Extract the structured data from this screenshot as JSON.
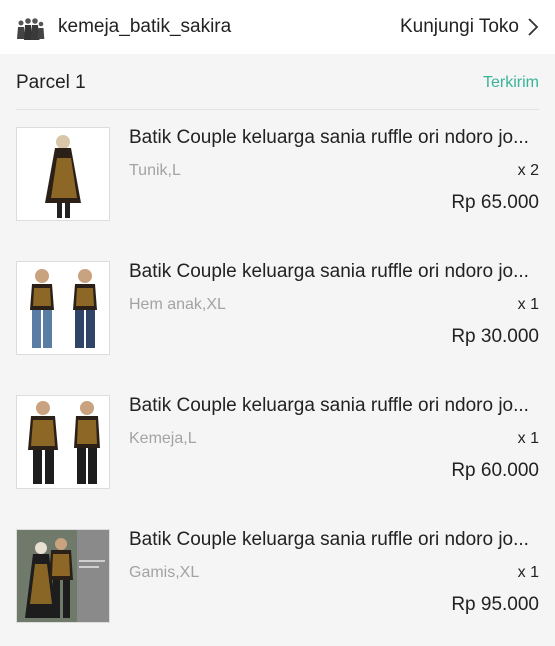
{
  "shop": {
    "name": "kemeja_batik_sakira",
    "visit_label": "Kunjungi Toko"
  },
  "parcel": {
    "title": "Parcel 1",
    "status": "Terkirim"
  },
  "items": [
    {
      "name": "Batik Couple keluarga sania ruffle ori ndoro jo...",
      "variant": "Tunik,L",
      "qty": "x 2",
      "price": "Rp 65.000"
    },
    {
      "name": "Batik Couple keluarga sania ruffle ori ndoro jo...",
      "variant": "Hem anak,XL",
      "qty": "x 1",
      "price": "Rp 30.000"
    },
    {
      "name": "Batik Couple keluarga sania ruffle ori ndoro jo...",
      "variant": "Kemeja,L",
      "qty": "x 1",
      "price": "Rp 60.000"
    },
    {
      "name": "Batik Couple keluarga sania ruffle ori ndoro jo...",
      "variant": "Gamis,XL",
      "qty": "x 1",
      "price": "Rp 95.000"
    }
  ],
  "colors": {
    "status": "#39b39a",
    "muted_text": "#a3a3a3",
    "background": "#f5f5f5"
  },
  "icons": {
    "shop_avatar": "family-batik-avatar",
    "visit_chevron": "chevron-right-icon"
  }
}
